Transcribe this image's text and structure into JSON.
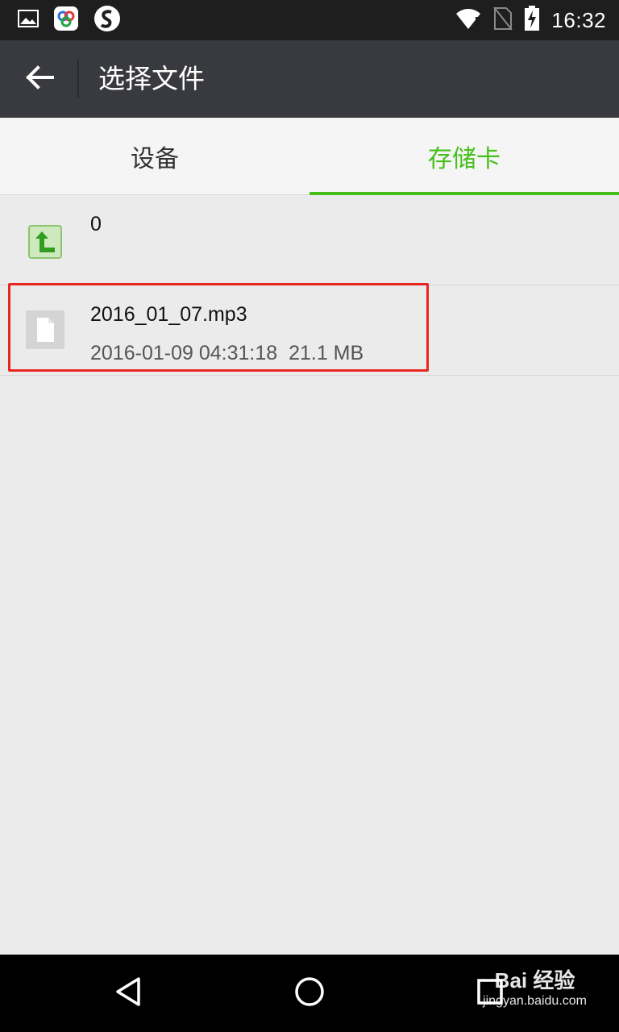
{
  "status_bar": {
    "time": "16:32",
    "left_icons": [
      "image-icon",
      "baidu-cloud-icon",
      "s-app-icon"
    ],
    "right_icons": [
      "wifi-icon",
      "no-sim-icon",
      "battery-charging-icon"
    ]
  },
  "toolbar": {
    "back_icon": "arrow-left-icon",
    "title": "选择文件"
  },
  "tabs": [
    {
      "label": "设备",
      "active": false
    },
    {
      "label": "存储卡",
      "active": true
    }
  ],
  "colors": {
    "accent": "#45c01a",
    "toolbar": "#393a3f",
    "highlight": "#e8261e"
  },
  "list": {
    "items": [
      {
        "icon": "folder-up-icon",
        "title": "0"
      },
      {
        "icon": "file-icon",
        "title": "2016_01_07.mp3",
        "date": "2016-01-09 04:31:18",
        "size": "21.1 MB"
      }
    ]
  },
  "nav_bar": {
    "icons": [
      "back-triangle-icon",
      "home-circle-icon",
      "recents-square-icon"
    ]
  },
  "watermark": {
    "logo": "Bai 经验",
    "sub": "jingyan.baidu.com"
  }
}
